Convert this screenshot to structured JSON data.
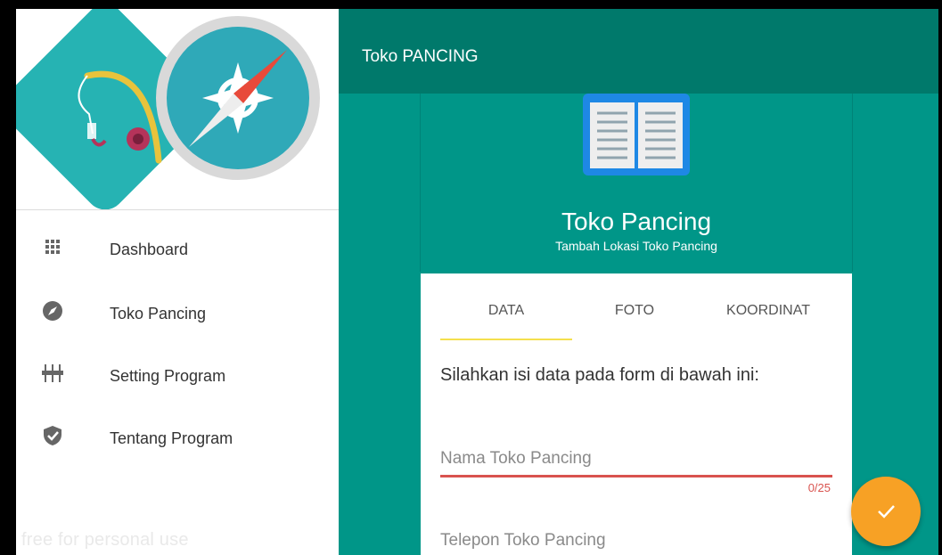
{
  "drawer": {
    "items": [
      {
        "label": "Dashboard",
        "icon": "grid-icon"
      },
      {
        "label": "Toko Pancing",
        "icon": "compass-icon"
      },
      {
        "label": "Setting Program",
        "icon": "equalizer-icon"
      },
      {
        "label": "Tentang Program",
        "icon": "shield-check-icon"
      }
    ],
    "watermark": "free for personal use"
  },
  "appbar": {
    "title": "Toko PANCING"
  },
  "card": {
    "title": "Toko Pancing",
    "subtitle": "Tambah Lokasi Toko Pancing",
    "tabs": [
      {
        "label": "DATA",
        "selected": true
      },
      {
        "label": "FOTO",
        "selected": false
      },
      {
        "label": "KOORDINAT",
        "selected": false
      }
    ],
    "instruction": "Silahkan isi data pada form di bawah ini:",
    "fields": {
      "nama_placeholder": "Nama Toko Pancing",
      "nama_counter": "0/25",
      "telepon_placeholder": "Telepon Toko Pancing"
    }
  },
  "colors": {
    "primary": "#009688",
    "primary_dark": "#00796b",
    "accent": "#f7a125",
    "tab_indicator": "#f4e04d",
    "error": "#d9534f"
  }
}
